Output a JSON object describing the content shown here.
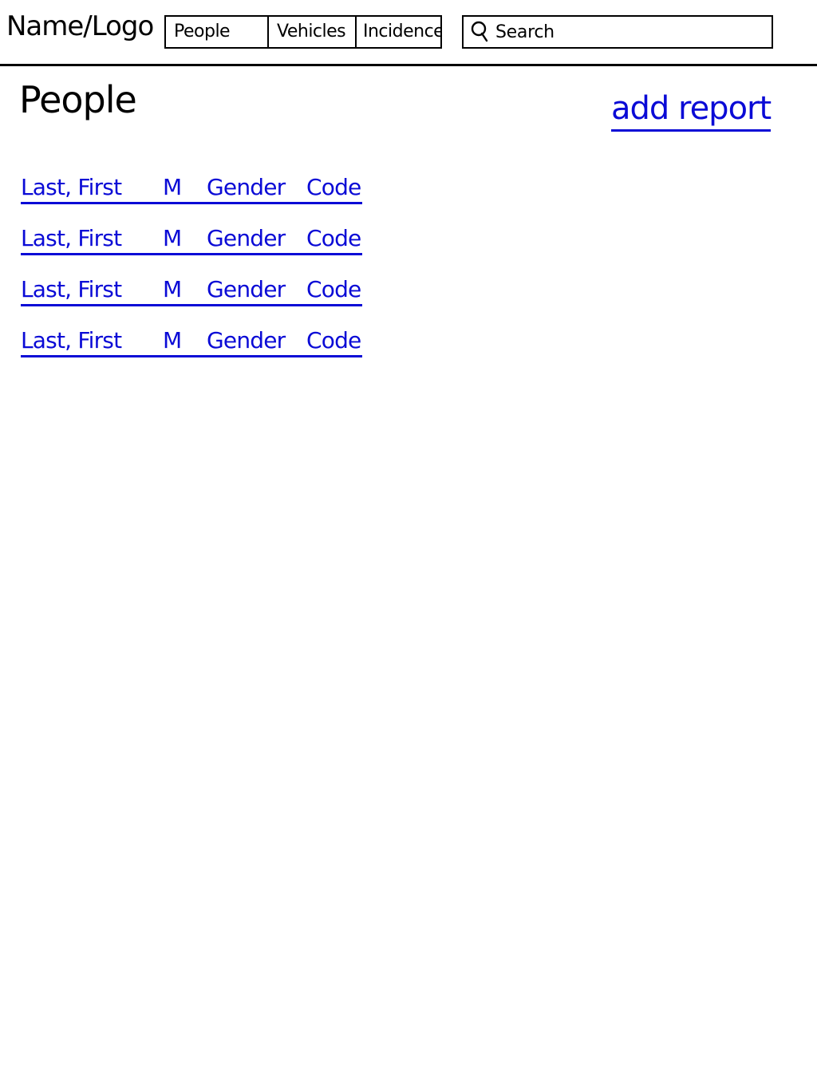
{
  "header": {
    "logo": "Name/Logo",
    "nav": [
      "People",
      "Vehicles",
      "Incidence"
    ],
    "search_label": "Search"
  },
  "page": {
    "title": "People",
    "add_report": "add report"
  },
  "people": [
    {
      "name": "Last, First",
      "middle": "M",
      "gender": "Gender",
      "code": "Code"
    },
    {
      "name": "Last, First",
      "middle": "M",
      "gender": "Gender",
      "code": "Code"
    },
    {
      "name": "Last, First",
      "middle": "M",
      "gender": "Gender",
      "code": "Code"
    },
    {
      "name": "Last, First",
      "middle": "M",
      "gender": "Gender",
      "code": "Code"
    }
  ],
  "colors": {
    "link": "#0a0ad6",
    "ink": "#000000"
  }
}
